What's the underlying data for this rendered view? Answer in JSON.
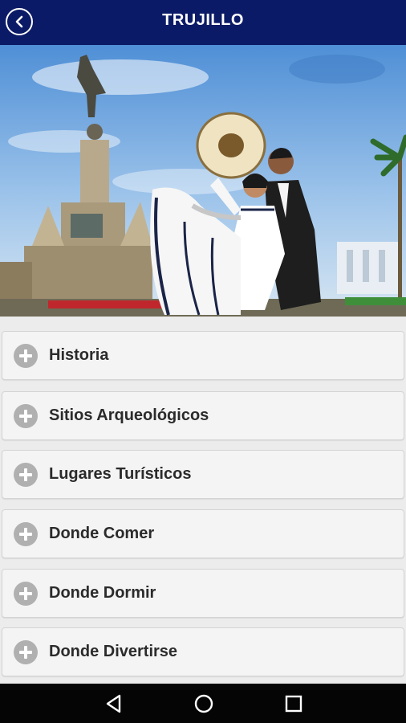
{
  "app_bar": {
    "title": "TRUJILLO",
    "back_icon": "chevron-left-icon",
    "background_color": "#0b1a66"
  },
  "hero": {
    "description_icon": "photo"
  },
  "menu": {
    "expand_icon": "plus-circle-icon",
    "items": [
      {
        "label": "Historia"
      },
      {
        "label": "Sitios Arqueológicos"
      },
      {
        "label": "Lugares Turísticos"
      },
      {
        "label": "Donde Comer"
      },
      {
        "label": "Donde Dormir"
      },
      {
        "label": "Donde Divertirse"
      }
    ]
  },
  "system_nav": {
    "back": "back-triangle-icon",
    "home": "home-circle-icon",
    "recents": "recents-square-icon"
  }
}
